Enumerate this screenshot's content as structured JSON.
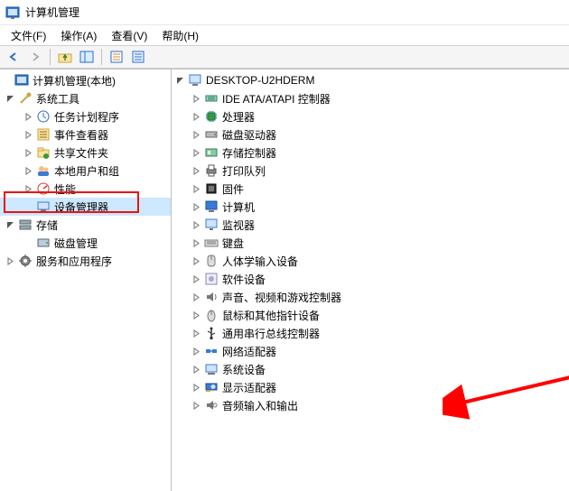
{
  "window": {
    "title": "计算机管理"
  },
  "menu": {
    "file": "文件(F)",
    "action": "操作(A)",
    "view": "查看(V)",
    "help": "帮助(H)"
  },
  "toolbar": {
    "back": "back",
    "forward": "forward",
    "up": "up",
    "show": "show",
    "refresh": "refresh",
    "properties": "properties"
  },
  "left_tree": {
    "root": {
      "label": "计算机管理(本地)",
      "icon": "mmc-root-icon",
      "expanded": true
    },
    "system_tools": {
      "label": "系统工具",
      "icon": "tools-icon",
      "expanded": true
    },
    "system_tools_children": [
      {
        "label": "任务计划程序",
        "icon": "task-scheduler-icon",
        "expandable": true
      },
      {
        "label": "事件查看器",
        "icon": "event-viewer-icon",
        "expandable": true
      },
      {
        "label": "共享文件夹",
        "icon": "shared-folders-icon",
        "expandable": true
      },
      {
        "label": "本地用户和组",
        "icon": "users-groups-icon",
        "expandable": true
      },
      {
        "label": "性能",
        "icon": "performance-icon",
        "expandable": true
      },
      {
        "label": "设备管理器",
        "icon": "device-manager-icon",
        "expandable": false,
        "selected": true
      }
    ],
    "storage": {
      "label": "存储",
      "icon": "storage-icon",
      "expanded": true
    },
    "storage_children": [
      {
        "label": "磁盘管理",
        "icon": "disk-mgmt-icon",
        "expandable": false
      }
    ],
    "services_apps": {
      "label": "服务和应用程序",
      "icon": "services-icon",
      "expandable": true
    }
  },
  "right_tree": {
    "root": {
      "label": "DESKTOP-U2HDERM",
      "icon": "computer-icon",
      "expanded": true
    },
    "items": [
      {
        "label": "IDE ATA/ATAPI 控制器",
        "icon": "ide-icon"
      },
      {
        "label": "处理器",
        "icon": "cpu-icon"
      },
      {
        "label": "磁盘驱动器",
        "icon": "disk-icon"
      },
      {
        "label": "存储控制器",
        "icon": "storage-ctrl-icon"
      },
      {
        "label": "打印队列",
        "icon": "printer-icon"
      },
      {
        "label": "固件",
        "icon": "firmware-icon"
      },
      {
        "label": "计算机",
        "icon": "monitor-icon"
      },
      {
        "label": "监视器",
        "icon": "display-icon"
      },
      {
        "label": "键盘",
        "icon": "keyboard-icon"
      },
      {
        "label": "人体学输入设备",
        "icon": "hid-icon"
      },
      {
        "label": "软件设备",
        "icon": "software-icon"
      },
      {
        "label": "声音、视频和游戏控制器",
        "icon": "sound-icon"
      },
      {
        "label": "鼠标和其他指针设备",
        "icon": "mouse-icon"
      },
      {
        "label": "通用串行总线控制器",
        "icon": "usb-icon"
      },
      {
        "label": "网络适配器",
        "icon": "network-icon"
      },
      {
        "label": "系统设备",
        "icon": "system-icon"
      },
      {
        "label": "显示适配器",
        "icon": "gpu-icon"
      },
      {
        "label": "音频输入和输出",
        "icon": "audio-io-icon"
      }
    ]
  },
  "annotations": {
    "highlight_target": "设备管理器",
    "arrow_target": "显示适配器"
  }
}
